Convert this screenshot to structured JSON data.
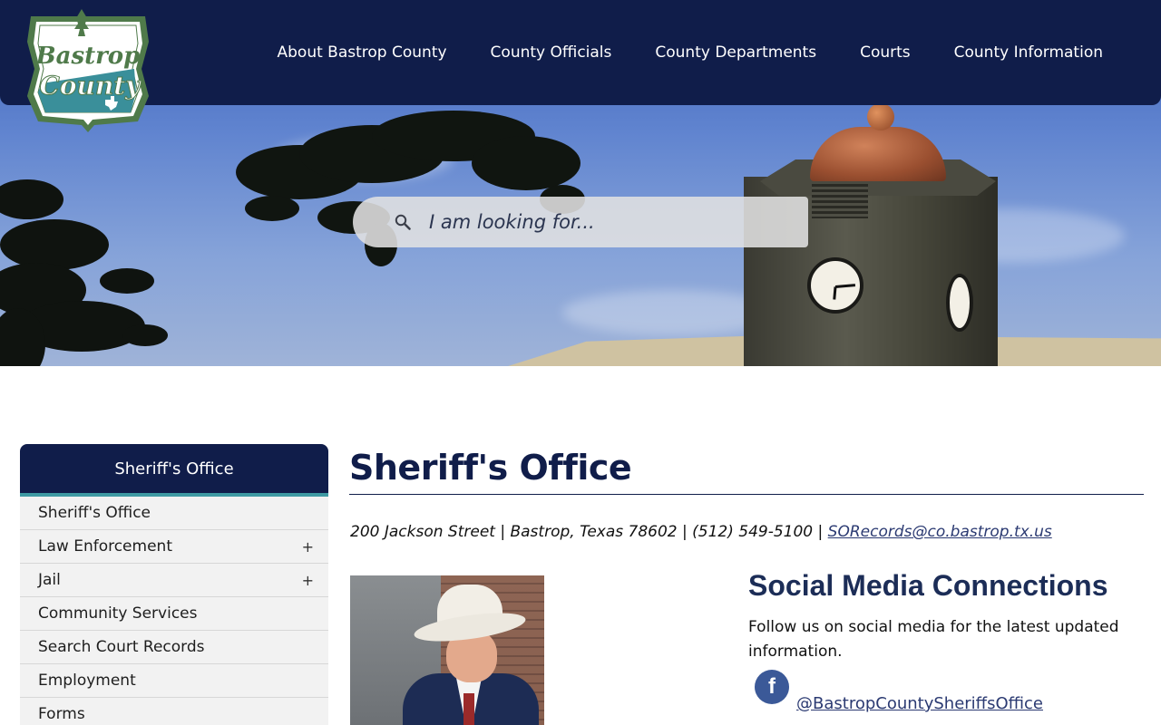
{
  "header": {
    "logo_text_line1": "Bastrop",
    "logo_text_line2": "County",
    "nav": [
      {
        "label": "About Bastrop County"
      },
      {
        "label": "County Officials"
      },
      {
        "label": "County Departments"
      },
      {
        "label": "Courts"
      },
      {
        "label": "County Information"
      }
    ]
  },
  "search": {
    "placeholder": "I am looking for...",
    "icon": "search-icon"
  },
  "sidebar": {
    "title": "Sheriff's Office",
    "items": [
      {
        "label": "Sheriff's Office",
        "expand": ""
      },
      {
        "label": "Law Enforcement",
        "expand": "+"
      },
      {
        "label": "Jail",
        "expand": "+"
      },
      {
        "label": "Community Services",
        "expand": ""
      },
      {
        "label": "Search Court Records",
        "expand": ""
      },
      {
        "label": "Employment",
        "expand": ""
      },
      {
        "label": "Forms",
        "expand": ""
      }
    ]
  },
  "main": {
    "title": "Sheriff's Office",
    "address": "200 Jackson Street | Bastrop, Texas 78602 | (512) 549-5100 | ",
    "email": "SORecords@co.bastrop.tx.us",
    "social": {
      "title": "Social Media Connections",
      "text": "Follow us on social media for the latest updated information.",
      "facebook_icon": "facebook-icon",
      "facebook_glyph": "f",
      "facebook_handle": "@BastropCountySheriffsOffice"
    }
  },
  "colors": {
    "navy": "#101d4a",
    "teal_accent": "#3e9aa3",
    "facebook": "#3b5998",
    "logo_green": "#4f7a4a"
  }
}
